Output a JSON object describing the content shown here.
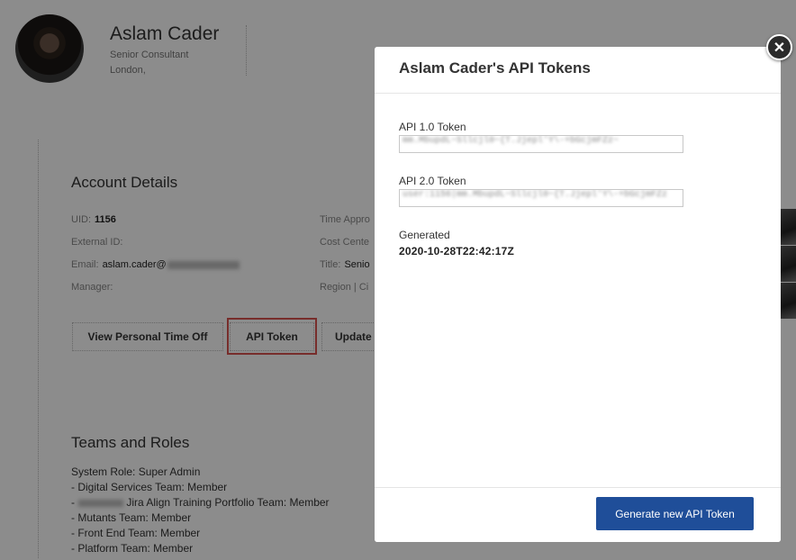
{
  "profile": {
    "name": "Aslam Cader",
    "title": "Senior Consultant",
    "location": "London,"
  },
  "account": {
    "heading": "Account Details",
    "uid_label": "UID:",
    "uid_value": "1156",
    "external_id_label": "External ID:",
    "email_label": "Email:",
    "email_value": "aslam.cader@",
    "manager_label": "Manager:",
    "time_approver_label": "Time Appro",
    "cost_center_label": "Cost Cente",
    "title_label": "Title:",
    "title_value": "Senio",
    "region_label": "Region | Ci"
  },
  "buttons": {
    "view_pto": "View Personal Time Off",
    "api_token": "API Token",
    "update": "Update"
  },
  "teams": {
    "heading": "Teams and Roles",
    "system_role": "System Role: Super Admin",
    "items": [
      "- Digital Services Team: Member",
      "Jira Align Training Portfolio Team: Member",
      "- Mutants Team: Member",
      "- Front End Team: Member",
      "- Platform Team: Member"
    ]
  },
  "modal": {
    "title": "Aslam Cader's API Tokens",
    "api1_label": "API 1.0 Token",
    "api1_value": "mm.MbupdL~Sllcjl0~{T.Jjepl'Y\\-+bGcjmFZz~",
    "api2_label": "API 2.0 Token",
    "api2_value": "user:1156|mm.MbupdL~Sllcjl0~{T.Jjepl'Y\\-+bGcjmFZz",
    "generated_label": "Generated",
    "generated_value": "2020-10-28T22:42:17Z",
    "generate_button": "Generate new API Token",
    "close_glyph": "✕"
  },
  "colors": {
    "primary": "#1f4e99",
    "highlight": "#d9534f"
  }
}
